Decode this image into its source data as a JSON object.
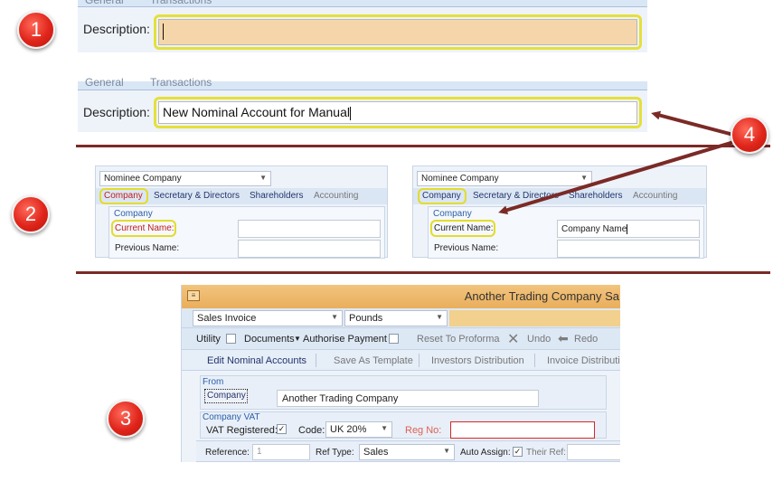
{
  "badges": [
    "1",
    "2",
    "3",
    "4"
  ],
  "section1": {
    "tabs": [
      "General",
      "Transactions"
    ],
    "label": "Description:",
    "empty_value": "",
    "filled_value": "New Nominal Account for Manual"
  },
  "section2": {
    "combo_value": "Nominee Company",
    "tabs": [
      "Company",
      "Secretary & Directors",
      "Shareholders",
      "Accounting"
    ],
    "group_title": "Company",
    "current_name_label": "Current Name:",
    "previous_name_label": "Previous Name:",
    "current_name_value": "Company Name"
  },
  "section3": {
    "title": "Another Trading Company Sa",
    "doc_type": "Sales Invoice",
    "currency": "Pounds",
    "toolbar": {
      "utility": "Utility",
      "documents": "Documents",
      "authorise": "Authorise Payment",
      "reset": "Reset To Proforma",
      "undo": "Undo",
      "redo": "Redo"
    },
    "actions": [
      "Edit Nominal Accounts",
      "Save As Template",
      "Investors Distribution",
      "Invoice Distributio"
    ],
    "from": {
      "title": "From",
      "company_button": "Company",
      "company_value": "Another Trading Company"
    },
    "vat": {
      "title": "Company VAT",
      "registered_label": "VAT Registered:",
      "code_label": "Code:",
      "code_value": "UK 20%",
      "reg_no_label": "Reg No:"
    },
    "reference": {
      "label": "Reference:",
      "value": "1",
      "ref_type_label": "Ref Type:",
      "ref_type_value": "Sales",
      "auto_assign_label": "Auto Assign:",
      "their_ref_label": "Their Ref:"
    }
  },
  "colors": {
    "badge_red": "#e0251b",
    "highlight_yellow": "#e5e03a",
    "arrow": "#7b2a26",
    "empty_field": "#f5d6aa"
  }
}
